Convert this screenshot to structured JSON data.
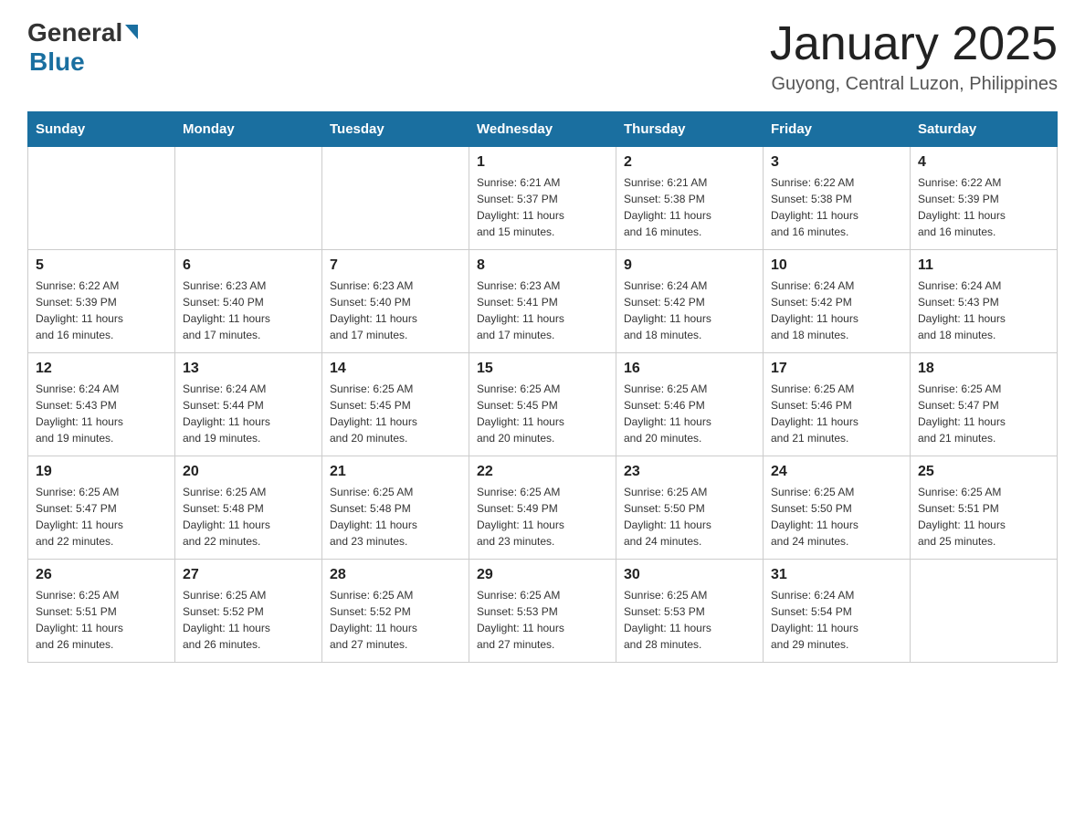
{
  "header": {
    "logo_general": "General",
    "logo_blue": "Blue",
    "month_title": "January 2025",
    "location": "Guyong, Central Luzon, Philippines"
  },
  "weekdays": [
    "Sunday",
    "Monday",
    "Tuesday",
    "Wednesday",
    "Thursday",
    "Friday",
    "Saturday"
  ],
  "weeks": [
    [
      {
        "day": "",
        "info": ""
      },
      {
        "day": "",
        "info": ""
      },
      {
        "day": "",
        "info": ""
      },
      {
        "day": "1",
        "info": "Sunrise: 6:21 AM\nSunset: 5:37 PM\nDaylight: 11 hours\nand 15 minutes."
      },
      {
        "day": "2",
        "info": "Sunrise: 6:21 AM\nSunset: 5:38 PM\nDaylight: 11 hours\nand 16 minutes."
      },
      {
        "day": "3",
        "info": "Sunrise: 6:22 AM\nSunset: 5:38 PM\nDaylight: 11 hours\nand 16 minutes."
      },
      {
        "day": "4",
        "info": "Sunrise: 6:22 AM\nSunset: 5:39 PM\nDaylight: 11 hours\nand 16 minutes."
      }
    ],
    [
      {
        "day": "5",
        "info": "Sunrise: 6:22 AM\nSunset: 5:39 PM\nDaylight: 11 hours\nand 16 minutes."
      },
      {
        "day": "6",
        "info": "Sunrise: 6:23 AM\nSunset: 5:40 PM\nDaylight: 11 hours\nand 17 minutes."
      },
      {
        "day": "7",
        "info": "Sunrise: 6:23 AM\nSunset: 5:40 PM\nDaylight: 11 hours\nand 17 minutes."
      },
      {
        "day": "8",
        "info": "Sunrise: 6:23 AM\nSunset: 5:41 PM\nDaylight: 11 hours\nand 17 minutes."
      },
      {
        "day": "9",
        "info": "Sunrise: 6:24 AM\nSunset: 5:42 PM\nDaylight: 11 hours\nand 18 minutes."
      },
      {
        "day": "10",
        "info": "Sunrise: 6:24 AM\nSunset: 5:42 PM\nDaylight: 11 hours\nand 18 minutes."
      },
      {
        "day": "11",
        "info": "Sunrise: 6:24 AM\nSunset: 5:43 PM\nDaylight: 11 hours\nand 18 minutes."
      }
    ],
    [
      {
        "day": "12",
        "info": "Sunrise: 6:24 AM\nSunset: 5:43 PM\nDaylight: 11 hours\nand 19 minutes."
      },
      {
        "day": "13",
        "info": "Sunrise: 6:24 AM\nSunset: 5:44 PM\nDaylight: 11 hours\nand 19 minutes."
      },
      {
        "day": "14",
        "info": "Sunrise: 6:25 AM\nSunset: 5:45 PM\nDaylight: 11 hours\nand 20 minutes."
      },
      {
        "day": "15",
        "info": "Sunrise: 6:25 AM\nSunset: 5:45 PM\nDaylight: 11 hours\nand 20 minutes."
      },
      {
        "day": "16",
        "info": "Sunrise: 6:25 AM\nSunset: 5:46 PM\nDaylight: 11 hours\nand 20 minutes."
      },
      {
        "day": "17",
        "info": "Sunrise: 6:25 AM\nSunset: 5:46 PM\nDaylight: 11 hours\nand 21 minutes."
      },
      {
        "day": "18",
        "info": "Sunrise: 6:25 AM\nSunset: 5:47 PM\nDaylight: 11 hours\nand 21 minutes."
      }
    ],
    [
      {
        "day": "19",
        "info": "Sunrise: 6:25 AM\nSunset: 5:47 PM\nDaylight: 11 hours\nand 22 minutes."
      },
      {
        "day": "20",
        "info": "Sunrise: 6:25 AM\nSunset: 5:48 PM\nDaylight: 11 hours\nand 22 minutes."
      },
      {
        "day": "21",
        "info": "Sunrise: 6:25 AM\nSunset: 5:48 PM\nDaylight: 11 hours\nand 23 minutes."
      },
      {
        "day": "22",
        "info": "Sunrise: 6:25 AM\nSunset: 5:49 PM\nDaylight: 11 hours\nand 23 minutes."
      },
      {
        "day": "23",
        "info": "Sunrise: 6:25 AM\nSunset: 5:50 PM\nDaylight: 11 hours\nand 24 minutes."
      },
      {
        "day": "24",
        "info": "Sunrise: 6:25 AM\nSunset: 5:50 PM\nDaylight: 11 hours\nand 24 minutes."
      },
      {
        "day": "25",
        "info": "Sunrise: 6:25 AM\nSunset: 5:51 PM\nDaylight: 11 hours\nand 25 minutes."
      }
    ],
    [
      {
        "day": "26",
        "info": "Sunrise: 6:25 AM\nSunset: 5:51 PM\nDaylight: 11 hours\nand 26 minutes."
      },
      {
        "day": "27",
        "info": "Sunrise: 6:25 AM\nSunset: 5:52 PM\nDaylight: 11 hours\nand 26 minutes."
      },
      {
        "day": "28",
        "info": "Sunrise: 6:25 AM\nSunset: 5:52 PM\nDaylight: 11 hours\nand 27 minutes."
      },
      {
        "day": "29",
        "info": "Sunrise: 6:25 AM\nSunset: 5:53 PM\nDaylight: 11 hours\nand 27 minutes."
      },
      {
        "day": "30",
        "info": "Sunrise: 6:25 AM\nSunset: 5:53 PM\nDaylight: 11 hours\nand 28 minutes."
      },
      {
        "day": "31",
        "info": "Sunrise: 6:24 AM\nSunset: 5:54 PM\nDaylight: 11 hours\nand 29 minutes."
      },
      {
        "day": "",
        "info": ""
      }
    ]
  ]
}
